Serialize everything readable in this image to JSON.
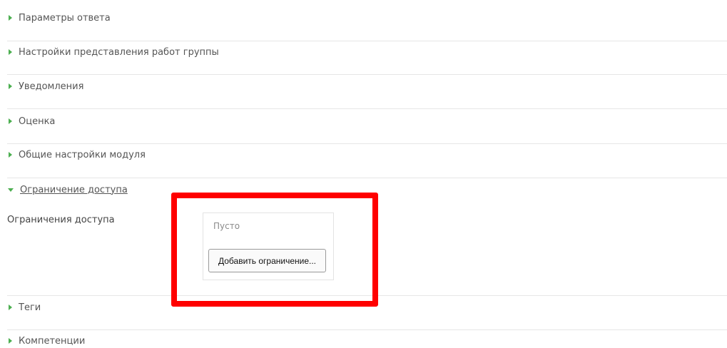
{
  "sections": [
    {
      "label": "Параметры ответа",
      "expanded": false
    },
    {
      "label": "Настройки представления работ группы",
      "expanded": false
    },
    {
      "label": "Уведомления",
      "expanded": false
    },
    {
      "label": "Оценка",
      "expanded": false
    },
    {
      "label": "Общие настройки модуля",
      "expanded": false
    },
    {
      "label": "Ограничение доступа",
      "expanded": true
    },
    {
      "label": "Теги",
      "expanded": false
    },
    {
      "label": "Компетенции",
      "expanded": false
    }
  ],
  "access_restriction": {
    "field_label": "Ограничения доступа",
    "empty_text": "Пусто",
    "add_button_label": "Добавить ограничение..."
  },
  "colors": {
    "expand_icon": "#4caf50",
    "highlight_frame": "#ff0000"
  }
}
